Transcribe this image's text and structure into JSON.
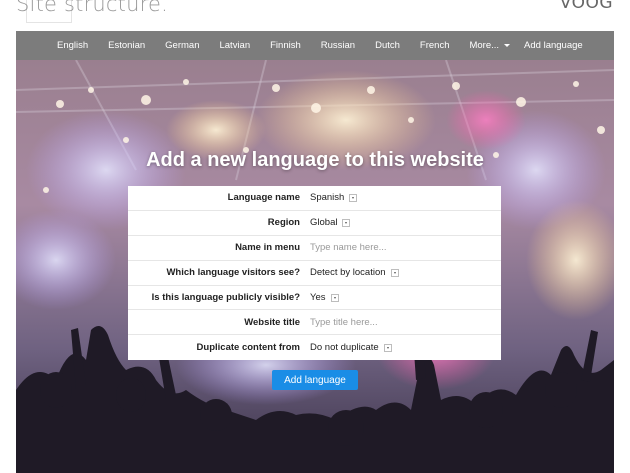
{
  "page": {
    "title": "Site structure.",
    "logo": "VOOG"
  },
  "nav": {
    "languages": [
      "English",
      "Estonian",
      "German",
      "Latvian",
      "Finnish",
      "Russian",
      "Dutch",
      "French"
    ],
    "more_label": "More...",
    "add_label": "Add language"
  },
  "form": {
    "heading": "Add a new language to this website",
    "rows": [
      {
        "label": "Language name",
        "value": "Spanish",
        "type": "select"
      },
      {
        "label": "Region",
        "value": "Global",
        "type": "select"
      },
      {
        "label": "Name in menu",
        "placeholder": "Type name here...",
        "type": "input"
      },
      {
        "label": "Which language visitors see?",
        "value": "Detect by location",
        "type": "select"
      },
      {
        "label": "Is this language publicly visible?",
        "value": "Yes",
        "type": "select"
      },
      {
        "label": "Website title",
        "placeholder": "Type title here...",
        "type": "input"
      },
      {
        "label": "Duplicate content from",
        "value": "Do not duplicate",
        "type": "select"
      }
    ],
    "submit_label": "Add language"
  },
  "colors": {
    "nav_bg": "#7c7c7c",
    "accent": "#1a8de6",
    "text": "#222222",
    "placeholder": "#9a9a9a"
  }
}
